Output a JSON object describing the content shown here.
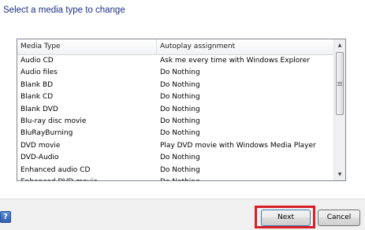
{
  "heading": "Select a media type to change",
  "list": {
    "columns": [
      "Media Type",
      "Autoplay assignment"
    ],
    "rows": [
      [
        "Audio CD",
        "Ask me every time with Windows Explorer"
      ],
      [
        "Audio files",
        "Do Nothing"
      ],
      [
        "Blank BD",
        "Do Nothing"
      ],
      [
        "Blank CD",
        "Do Nothing"
      ],
      [
        "Blank DVD",
        "Do Nothing"
      ],
      [
        "Blu-ray disc movie",
        "Do Nothing"
      ],
      [
        "BluRayBurning",
        "Do Nothing"
      ],
      [
        "DVD movie",
        "Play DVD movie with Windows Media Player"
      ],
      [
        "DVD-Audio",
        "Do Nothing"
      ],
      [
        "Enhanced audio CD",
        "Do Nothing"
      ],
      [
        "Enhanced DVD movie",
        "Do Nothing"
      ]
    ]
  },
  "scrollbar": {
    "up_glyph": "▲",
    "down_glyph": "▼"
  },
  "footer": {
    "help_glyph": "?",
    "next_label": "Next",
    "cancel_label": "Cancel"
  },
  "colors": {
    "heading": "#1e3287",
    "highlight": "#d61f26"
  }
}
